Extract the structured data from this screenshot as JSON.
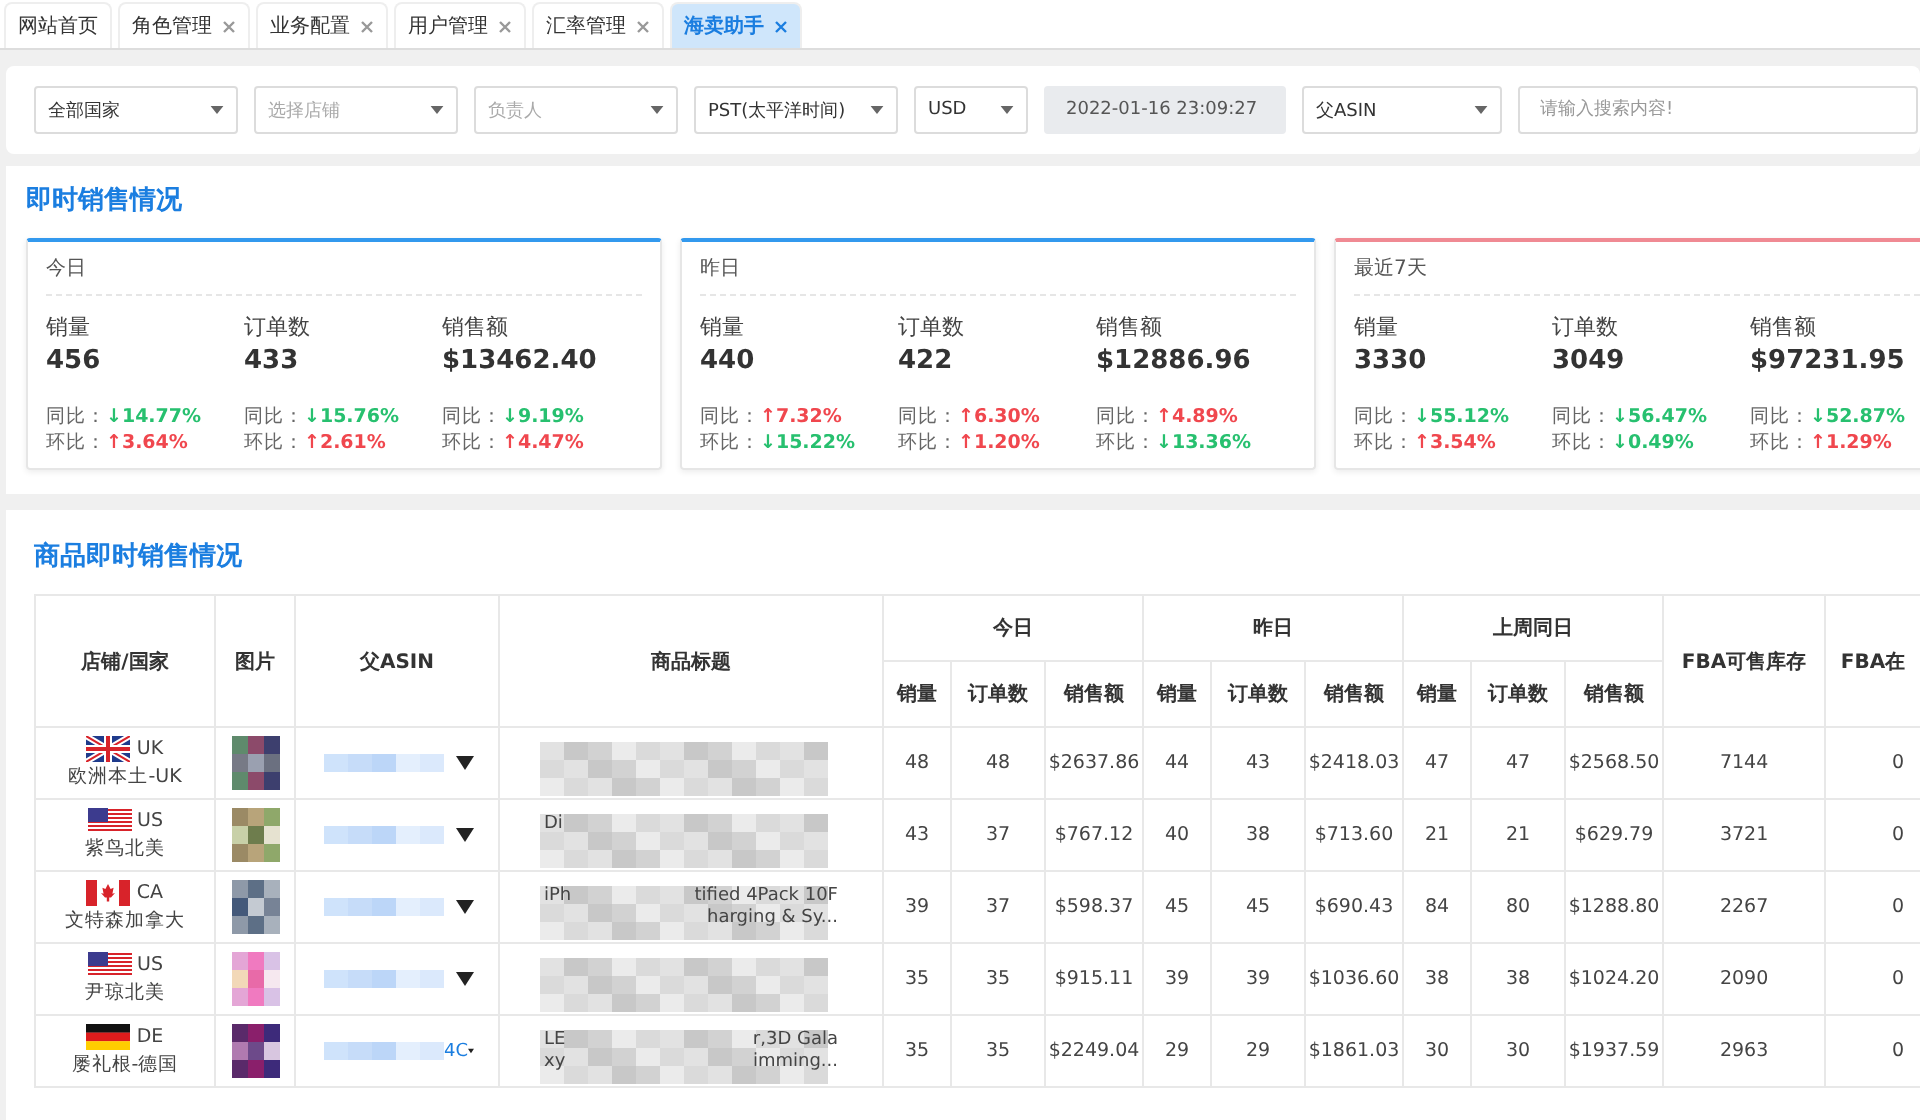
{
  "tabs": [
    {
      "label": "网站首页",
      "closable": false,
      "selected": false
    },
    {
      "label": "角色管理",
      "closable": true,
      "selected": false
    },
    {
      "label": "业务配置",
      "closable": true,
      "selected": false
    },
    {
      "label": "用户管理",
      "closable": true,
      "selected": false
    },
    {
      "label": "汇率管理",
      "closable": true,
      "selected": false
    },
    {
      "label": "海卖助手",
      "closable": true,
      "selected": true
    }
  ],
  "filters": [
    {
      "kind": "select",
      "value": "全部国家"
    },
    {
      "kind": "select",
      "placeholder": "选择店铺"
    },
    {
      "kind": "select",
      "placeholder": "负责人"
    },
    {
      "kind": "select",
      "value": "PST(太平洋时间)"
    },
    {
      "kind": "select",
      "value": "USD"
    },
    {
      "kind": "date",
      "value": "2022-01-16 23:09:27",
      "disabled": true
    },
    {
      "kind": "select",
      "value": "父ASIN"
    },
    {
      "kind": "search",
      "placeholder": "请输入搜索内容!"
    }
  ],
  "live_sales": {
    "title": "即时销售情况",
    "cards": [
      {
        "title": "今日",
        "color": "#3399ee",
        "metrics": [
          {
            "label": "销量",
            "value": "456",
            "yoy": {
              "label": "同比：",
              "value": "↓14.77%",
              "color": "#27c06f"
            },
            "mom": {
              "label": "环比：",
              "value": "↑3.64%",
              "color": "#f0474e"
            }
          },
          {
            "label": "订单数",
            "value": "433",
            "yoy": {
              "label": "同比：",
              "value": "↓15.76%",
              "color": "#27c06f"
            },
            "mom": {
              "label": "环比：",
              "value": "↑2.61%",
              "color": "#f0474e"
            }
          },
          {
            "label": "销售额",
            "value": "$13462.40",
            "yoy": {
              "label": "同比：",
              "value": "↓9.19%",
              "color": "#27c06f"
            },
            "mom": {
              "label": "环比：",
              "value": "↑4.47%",
              "color": "#f0474e"
            }
          }
        ]
      },
      {
        "title": "昨日",
        "color": "#3399ee",
        "metrics": [
          {
            "label": "销量",
            "value": "440",
            "yoy": {
              "label": "同比：",
              "value": "↑7.32%",
              "color": "#f0474e"
            },
            "mom": {
              "label": "环比：",
              "value": "↓15.22%",
              "color": "#27c06f"
            }
          },
          {
            "label": "订单数",
            "value": "422",
            "yoy": {
              "label": "同比：",
              "value": "↑6.30%",
              "color": "#f0474e"
            },
            "mom": {
              "label": "环比：",
              "value": "↑1.20%",
              "color": "#f0474e"
            }
          },
          {
            "label": "销售额",
            "value": "$12886.96",
            "yoy": {
              "label": "同比：",
              "value": "↑4.89%",
              "color": "#f0474e"
            },
            "mom": {
              "label": "环比：",
              "value": "↓13.36%",
              "color": "#27c06f"
            }
          }
        ]
      },
      {
        "title": "最近7天",
        "color": "#f08a93",
        "metrics": [
          {
            "label": "销量",
            "value": "3330",
            "yoy": {
              "label": "同比：",
              "value": "↓55.12%",
              "color": "#27c06f"
            },
            "mom": {
              "label": "环比：",
              "value": "↑3.54%",
              "color": "#f0474e"
            }
          },
          {
            "label": "订单数",
            "value": "3049",
            "yoy": {
              "label": "同比：",
              "value": "↓56.47%",
              "color": "#27c06f"
            },
            "mom": {
              "label": "环比：",
              "value": "↓0.49%",
              "color": "#27c06f"
            }
          },
          {
            "label": "销售额",
            "value": "$97231.95",
            "yoy": {
              "label": "同比：",
              "value": "↓52.87%",
              "color": "#27c06f"
            },
            "mom": {
              "label": "环比：",
              "value": "↑1.29%",
              "color": "#f0474e"
            }
          }
        ]
      }
    ]
  },
  "product_sales": {
    "title": "商品即时销售情况",
    "columns": [
      "店铺/国家",
      "图片",
      "父ASIN",
      "商品标题"
    ],
    "groups": [
      {
        "label": "今日",
        "sub_columns": [
          "销量",
          "订单数",
          "销售额"
        ]
      },
      {
        "label": "昨日",
        "sub_columns": [
          "销量",
          "订单数",
          "销售额"
        ]
      },
      {
        "label": "上周同日",
        "sub_columns": [
          "销量",
          "订单数",
          "销售额"
        ]
      }
    ],
    "tail_columns": [
      "FBA可售库存",
      "FBA在"
    ],
    "rows": [
      {
        "flag": {
          "kind": "uk"
        },
        "code": "UK",
        "store": "欧洲本土-UK",
        "thumbnail": {
          "kind": "picture"
        },
        "title": {},
        "today": [
          "48",
          "48",
          "$2637.86"
        ],
        "yesterday": [
          "44",
          "43",
          "$2418.03"
        ],
        "last_week": [
          "47",
          "47",
          "$2568.50"
        ],
        "fba_stock": "7144",
        "fba_transit": "0"
      },
      {
        "flag": {
          "kind": "us"
        },
        "code": "US",
        "store": "紫鸟北美",
        "thumbnail": {
          "kind": "picture"
        },
        "title": {
          "line1_left": "Di"
        },
        "today": [
          "43",
          "37",
          "$767.12"
        ],
        "yesterday": [
          "40",
          "38",
          "$713.60"
        ],
        "last_week": [
          "21",
          "21",
          "$629.79"
        ],
        "fba_stock": "3721",
        "fba_transit": "0"
      },
      {
        "flag": {
          "kind": "ca"
        },
        "code": "CA",
        "store": "文特森加拿大",
        "thumbnail": {
          "kind": "picture"
        },
        "title": {
          "line1_left": "iPh",
          "line1_right": "tified 4Pack 10F",
          "line2_right": "harging & Sy..."
        },
        "today": [
          "39",
          "37",
          "$598.37"
        ],
        "yesterday": [
          "45",
          "45",
          "$690.43"
        ],
        "last_week": [
          "84",
          "80",
          "$1288.80"
        ],
        "fba_stock": "2267",
        "fba_transit": "0"
      },
      {
        "flag": {
          "kind": "us"
        },
        "code": "US",
        "store": "尹琼北美",
        "thumbnail": {
          "kind": "picture"
        },
        "title": {},
        "today": [
          "35",
          "35",
          "$915.11"
        ],
        "yesterday": [
          "39",
          "39",
          "$1036.60"
        ],
        "last_week": [
          "38",
          "38",
          "$1024.20"
        ],
        "fba_stock": "2090",
        "fba_transit": "0"
      },
      {
        "flag": {
          "kind": "de"
        },
        "code": "DE",
        "store": "屡礼根-德国",
        "thumbnail": {
          "kind": "picture"
        },
        "asin_visible": "4C",
        "title": {
          "line1_left": "LE",
          "line1_right": "r,3D Gala",
          "line2_left": "xy",
          "line2_right": "imming..."
        },
        "today": [
          "35",
          "35",
          "$2249.04"
        ],
        "yesterday": [
          "29",
          "29",
          "$1861.03"
        ],
        "last_week": [
          "30",
          "30",
          "$1937.59"
        ],
        "fba_stock": "2963",
        "fba_transit": "0"
      }
    ]
  }
}
